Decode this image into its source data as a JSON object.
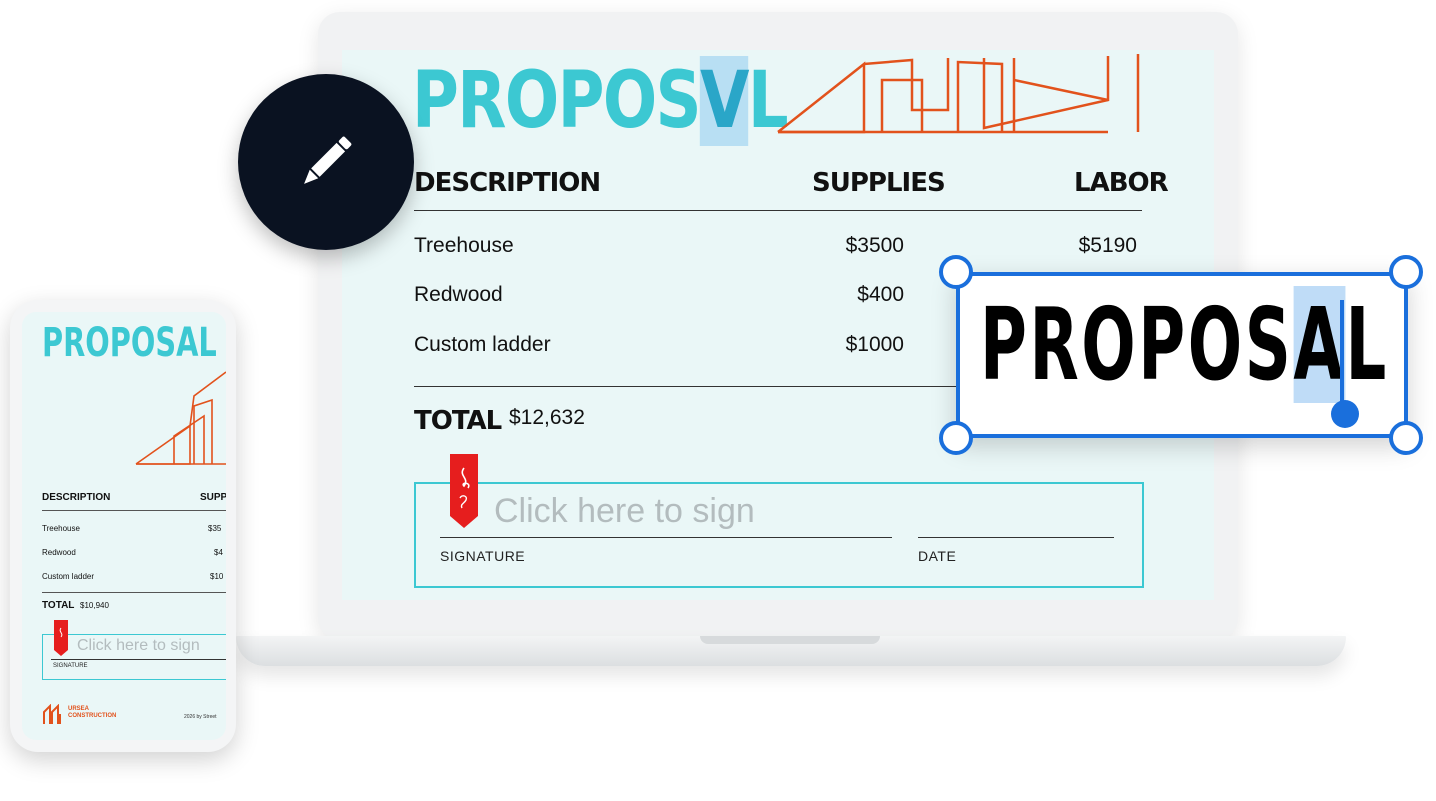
{
  "laptop": {
    "title_prefix": "PROPOS",
    "title_highlight": "V",
    "title_suffix": "L",
    "headers": {
      "description": "DESCRIPTION",
      "supplies": "SUPPLIES",
      "labor": "LABOR"
    },
    "rows": [
      {
        "label": "Treehouse",
        "supplies": "$3500",
        "labor": "$5190"
      },
      {
        "label": "Redwood",
        "supplies": "$400"
      },
      {
        "label": "Custom ladder",
        "supplies": "$1000"
      }
    ],
    "total_label": "TOTAL",
    "total_value": "$12,632",
    "signature": {
      "placeholder": "Click here to sign",
      "signature_label": "SIGNATURE",
      "date_label": "DATE"
    }
  },
  "edit_box": {
    "text_prefix": "PROPOS",
    "text_highlight": "A",
    "text_suffix": "L"
  },
  "phone": {
    "title": "PROPOSAL",
    "headers": {
      "description": "DESCRIPTION",
      "supplies": "SUPP"
    },
    "rows": [
      {
        "label": "Treehouse",
        "supplies": "$35"
      },
      {
        "label": "Redwood",
        "supplies": "$4"
      },
      {
        "label": "Custom ladder",
        "supplies": "$10"
      }
    ],
    "total_label": "TOTAL",
    "total_value": "$10,940",
    "signature": {
      "placeholder": "Click here to sign",
      "signature_label": "SIGNATURE"
    },
    "footer": {
      "company": "URSEA CONSTRUCTION",
      "right_text": "2026 by Street"
    }
  },
  "colors": {
    "accent_teal": "#3cc8d2",
    "accent_orange": "#e2521c",
    "selection_blue": "#1a6fdc",
    "badge_dark": "#0a1221",
    "bookmark_red": "#e61e1e"
  },
  "icons": [
    "pencil-icon",
    "acrobat-sign-bookmark-icon",
    "company-logo-icon"
  ]
}
